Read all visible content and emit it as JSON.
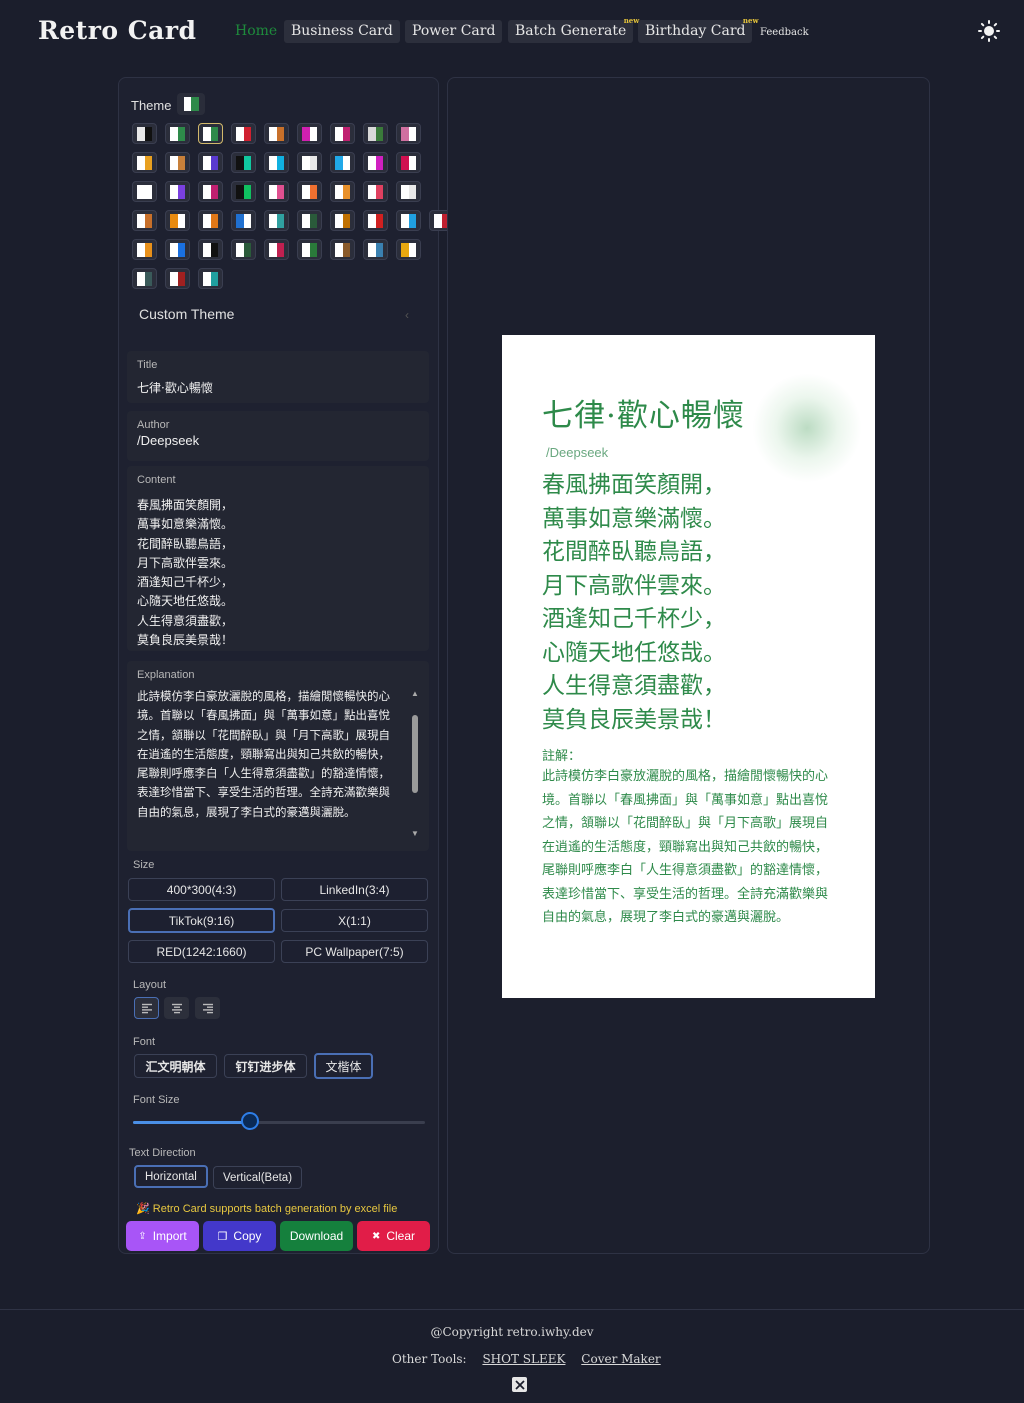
{
  "nav": {
    "logo": "Retro Card",
    "items": [
      {
        "label": "Home"
      },
      {
        "label": "Business Card"
      },
      {
        "label": "Power Card"
      },
      {
        "label": "Batch Generate",
        "badge": "new"
      },
      {
        "label": "Birthday Card",
        "badge": "new"
      },
      {
        "label": "Feedback"
      }
    ],
    "theme_toggle_icon": "sun-icon"
  },
  "settings": {
    "theme_label": "Theme",
    "custom_theme_label": "Custom Theme",
    "swatches": [
      [
        "#e8e8e8",
        "#111111"
      ],
      [
        "#ffffff",
        "#2e8a4a"
      ],
      [
        "#ffffff",
        "#2e8a4a"
      ],
      [
        "#ffffff",
        "#d02030"
      ],
      [
        "#ffffff",
        "#c8702a"
      ],
      [
        "#d020b0",
        "#ffffff"
      ],
      [
        "#ffffff",
        "#c02070"
      ],
      [
        "#d8d8d8",
        "#3a7a3a"
      ],
      [
        "#d070a0",
        "#ffffff"
      ],
      [
        "#ffffff",
        "#e8a020"
      ],
      [
        "#ffffff",
        "#c8803a"
      ],
      [
        "#ffffff",
        "#5a3ad0"
      ],
      [
        "#111111",
        "#10c8a0"
      ],
      [
        "#ffffff",
        "#10b0e0"
      ],
      [
        "#ffffff",
        "#e8e8e8"
      ],
      [
        "#20a8e8",
        "#ffffff"
      ],
      [
        "#ffffff",
        "#d020c0"
      ],
      [
        "#d01050",
        "#ffffff"
      ],
      [
        "#ffffff",
        "#ffffff"
      ],
      [
        "#ffffff",
        "#7a40e0"
      ],
      [
        "#ffffff",
        "#c02070"
      ],
      [
        "#111111",
        "#10c060"
      ],
      [
        "#ffffff",
        "#e05090"
      ],
      [
        "#ffffff",
        "#f07030"
      ],
      [
        "#ffffff",
        "#e8902a"
      ],
      [
        "#ffffff",
        "#e04060"
      ],
      [
        "#ffffff",
        "#e8e8e8"
      ],
      [
        "#ffffff",
        "#c8702a"
      ],
      [
        "#e88a10",
        "#ffffff"
      ],
      [
        "#ffffff",
        "#e07818"
      ],
      [
        "#2070d0",
        "#ffffff"
      ],
      [
        "#ffffff",
        "#30a0a0"
      ],
      [
        "#ffffff",
        "#2a5a3a"
      ],
      [
        "#ffffff",
        "#c07000"
      ],
      [
        "#ffffff",
        "#d02020"
      ],
      [
        "#ffffff",
        "#20a0e0"
      ],
      [
        "#ffffff",
        "#c02030"
      ],
      [
        "#ffffff",
        "#e8901a"
      ],
      [
        "#ffffff",
        "#1a70e0"
      ],
      [
        "#ffffff",
        "#111111"
      ],
      [
        "#ffffff",
        "#2a5a3a"
      ],
      [
        "#ffffff",
        "#c02050"
      ],
      [
        "#ffffff",
        "#2a7a3a"
      ],
      [
        "#ffffff",
        "#8a5a2a"
      ],
      [
        "#ffffff",
        "#3a80b0"
      ],
      [
        "#e8a810",
        "#ffffff"
      ],
      [
        "#ffffff",
        "#3a5a5a"
      ],
      [
        "#ffffff",
        "#a02020"
      ],
      [
        "#ffffff",
        "#20a0a0"
      ]
    ],
    "title": {
      "label": "Title",
      "value": "七律·歡心暢懷"
    },
    "author": {
      "label": "Author",
      "value": "/Deepseek"
    },
    "content": {
      "label": "Content",
      "value": "春風拂面笑顏開，\n萬事如意樂滿懷。\n花間醉臥聽鳥語，\n月下高歌伴雲來。\n酒逢知己千杯少，\n心隨天地任悠哉。\n人生得意須盡歡，\n莫負良辰美景哉！"
    },
    "explanation": {
      "label": "Explanation",
      "value": "此詩模仿李白豪放灑脫的風格，描繪閒懷暢快的心境。首聯以「春風拂面」與「萬事如意」點出喜悅之情，頷聯以「花間醉臥」與「月下高歌」展現自在逍遙的生活態度，頸聯寫出與知己共飲的暢快，尾聯則呼應李白「人生得意須盡歡」的豁達情懷，表達珍惜當下、享受生活的哲理。全詩充滿歡樂與自由的氣息，展現了李白式的豪邁與灑脫。"
    },
    "size": {
      "label": "Size",
      "options": [
        "400*300(4:3)",
        "LinkedIn(3:4)",
        "TikTok(9:16)",
        "X(1:1)",
        "RED(1242:1660)",
        "PC Wallpaper(7:5)"
      ],
      "selected": "TikTok(9:16)"
    },
    "layout": {
      "label": "Layout",
      "options": [
        "align-left-icon",
        "align-center-icon",
        "align-right-icon"
      ],
      "selected": "align-left-icon"
    },
    "font": {
      "label": "Font",
      "options": [
        "汇文明朝体",
        "钉钉进步体",
        "文楷体"
      ],
      "selected": "文楷体"
    },
    "font_size": {
      "label": "Font Size",
      "value": 0.4
    },
    "text_direction": {
      "label": "Text Direction",
      "options": [
        "Horizontal",
        "Vertical(Beta)"
      ],
      "selected": "Horizontal"
    },
    "tip": "Retro Card supports batch generation by excel file",
    "actions": [
      {
        "label": "Import",
        "color": "#a855f7"
      },
      {
        "label": "Copy",
        "color": "#4338ca"
      },
      {
        "label": "Download",
        "color": "#15803d"
      },
      {
        "label": "Clear",
        "color": "#e11d48"
      }
    ]
  },
  "preview": {
    "note_label": "註解："
  },
  "footer": {
    "copyright": "@Copyright retro.iwhy.dev",
    "other_tools_label": "Other Tools:",
    "links": [
      "SHOT SLEEK",
      "Cover Maker"
    ],
    "social_icon": "x-icon"
  },
  "colors": {
    "background": "#1b1e2c",
    "accent": "#2e8a4a",
    "selected_border": "#4a6fb5"
  }
}
